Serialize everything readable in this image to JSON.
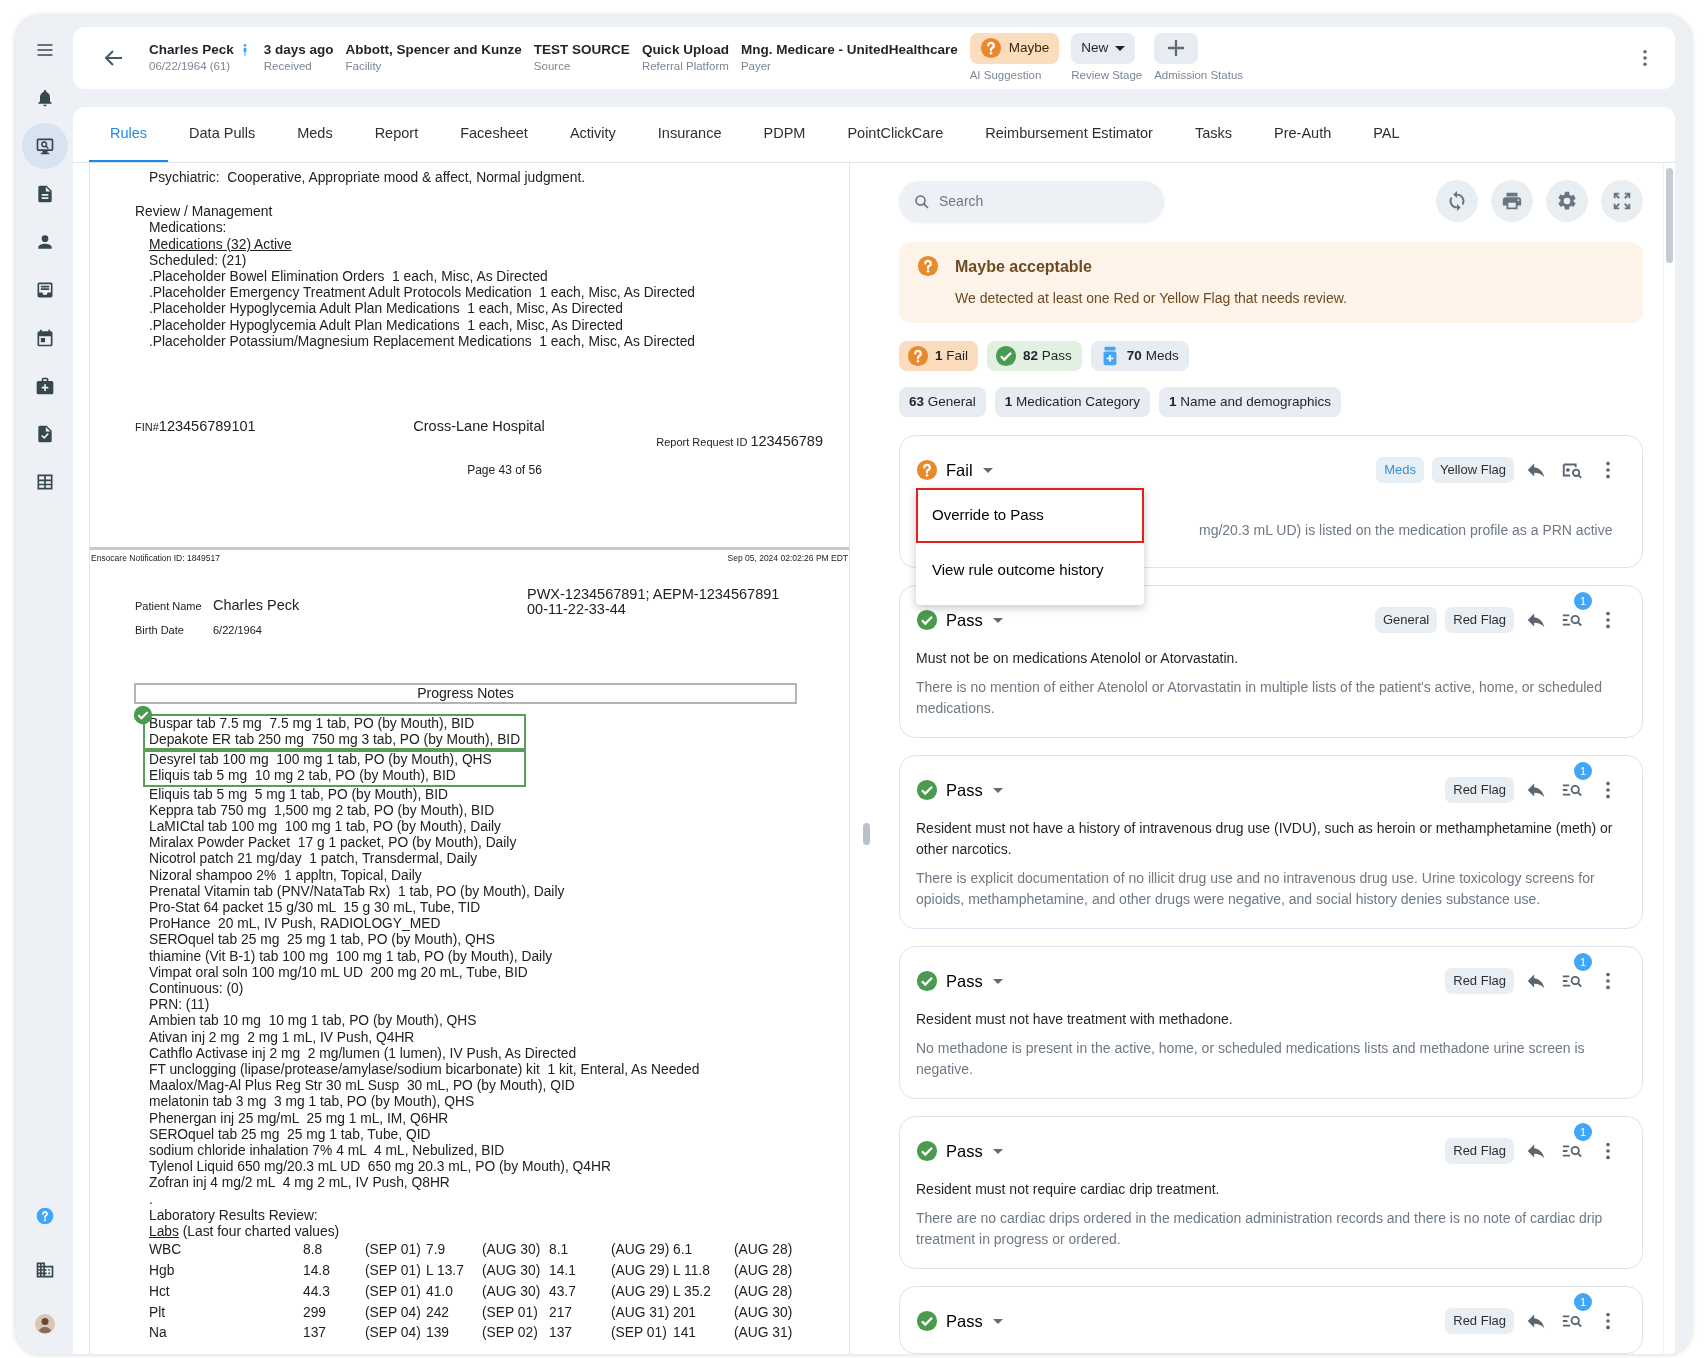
{
  "sidebar": {
    "items": [
      {
        "selected": false
      },
      {
        "selected": true
      },
      {
        "selected": false
      },
      {
        "selected": false
      },
      {
        "selected": false
      },
      {
        "selected": false
      },
      {
        "selected": false
      },
      {
        "selected": false
      },
      {
        "selected": false
      }
    ]
  },
  "header": {
    "patient": {
      "name": "Charles Peck",
      "dob": "06/22/1964 (61)"
    },
    "fields": [
      {
        "value": "3 days ago",
        "label": "Received"
      },
      {
        "value": "Abbott, Spencer and Kunze",
        "label": "Facility"
      },
      {
        "value": "TEST SOURCE",
        "label": "Source"
      },
      {
        "value": "Quick Upload",
        "label": "Referral Platform"
      },
      {
        "value": "Mng. Medicare - UnitedHealthcare",
        "label": "Payer"
      }
    ],
    "ai_suggestion": {
      "value": "Maybe",
      "label": "AI Suggestion"
    },
    "review_stage": {
      "value": "New",
      "label": "Review Stage"
    },
    "admission_status": {
      "label": "Admission Status"
    }
  },
  "tabs": [
    {
      "label": "Rules",
      "selected": true
    },
    {
      "label": "Data Pulls",
      "selected": false
    },
    {
      "label": "Meds",
      "selected": false
    },
    {
      "label": "Report",
      "selected": false
    },
    {
      "label": "Facesheet",
      "selected": false
    },
    {
      "label": "Activity",
      "selected": false
    },
    {
      "label": "Insurance",
      "selected": false
    },
    {
      "label": "PDPM",
      "selected": false
    },
    {
      "label": "PointClickCare",
      "selected": false
    },
    {
      "label": "Reimbursement Estimator",
      "selected": false
    },
    {
      "label": "Tasks",
      "selected": false
    },
    {
      "label": "Pre-Auth",
      "selected": false
    },
    {
      "label": "PAL",
      "selected": false
    }
  ],
  "document": {
    "intro": "Psychiatric:  Cooperative, Appropriate mood & affect, Normal judgment.",
    "review_heading": "Review / Management",
    "review_lines": [
      {
        "kind": "text",
        "text": "Medications:"
      },
      {
        "kind": "link",
        "text": "Medications (32) Active"
      },
      {
        "kind": "text",
        "text": "Scheduled: (21)"
      },
      {
        "kind": "text",
        "text": ".Placeholder Bowel Elimination Orders  1 each, Misc, As Directed"
      },
      {
        "kind": "text",
        "text": ".Placeholder Emergency Treatment Adult Protocols Medication  1 each, Misc, As Directed"
      },
      {
        "kind": "text",
        "text": ".Placeholder Hypoglycemia Adult Plan Medications  1 each, Misc, As Directed"
      },
      {
        "kind": "text",
        "text": ".Placeholder Hypoglycemia Adult Plan Medications  1 each, Misc, As Directed"
      },
      {
        "kind": "text",
        "text": ".Placeholder Potassium/Magnesium Replacement Medications  1 each, Misc, As Directed"
      }
    ],
    "footer": {
      "fin_label": "FIN#",
      "fin": "123456789101",
      "hospital": "Cross-Lane Hospital",
      "report_label": "Report Request ID",
      "report_id": "123456789",
      "page": "Page 43 of 56"
    },
    "page_header": {
      "notification": "Ensocare Notification ID: 1849517",
      "timestamp": "Sep 05, 2024 02:02:26 PM EDT"
    },
    "patient": {
      "name_label": "Patient Name",
      "name": "Charles Peck",
      "birth_label": "Birth Date",
      "birth": "6/22/1964",
      "ids": [
        "PWX-1234567891; AEPM-1234567891",
        "00-11-22-33-44"
      ]
    },
    "notes_title": "Progress Notes",
    "highlight_groups": [
      [
        "Buspar tab 7.5 mg  7.5 mg 1 tab, PO (by Mouth), BID",
        "Depakote ER tab 250 mg  750 mg 3 tab, PO (by Mouth), BID"
      ],
      [
        "Desyrel tab 100 mg  100 mg 1 tab, PO (by Mouth), QHS",
        "Eliquis tab 5 mg  10 mg 2 tab, PO (by Mouth), BID"
      ]
    ],
    "med_lines": [
      "Eliquis tab 5 mg  5 mg 1 tab, PO (by Mouth), BID",
      "Keppra tab 750 mg  1,500 mg 2 tab, PO (by Mouth), BID",
      "LaMICtal tab 100 mg  100 mg 1 tab, PO (by Mouth), Daily",
      "Miralax Powder Packet  17 g 1 packet, PO (by Mouth), Daily",
      "Nicotrol patch 21 mg/day  1 patch, Transdermal, Daily",
      "Nizoral shampoo 2%  1 appltn, Topical, Daily",
      "Prenatal Vitamin tab (PNV/NataTab Rx)  1 tab, PO (by Mouth), Daily",
      "Pro-Stat 64 packet 15 g/30 mL  15 g 30 mL, Tube, TID",
      "ProHance  20 mL, IV Push, RADIOLOGY_MED",
      "SEROquel tab 25 mg  25 mg 1 tab, PO (by Mouth), QHS",
      "thiamine (Vit B-1) tab 100 mg  100 mg 1 tab, PO (by Mouth), Daily",
      "Vimpat oral soln 100 mg/10 mL UD  200 mg 20 mL, Tube, BID",
      "Continuous: (0)",
      "PRN: (11)",
      "Ambien tab 10 mg  10 mg 1 tab, PO (by Mouth), QHS",
      "Ativan inj 2 mg  2 mg 1 mL, IV Push, Q4HR",
      "Cathflo Activase inj 2 mg  2 mg/lumen (1 lumen), IV Push, As Directed",
      "FT unclogging (lipase/protease/amylase/sodium bicarbonate) kit  1 kit, Enteral, As Needed",
      "Maalox/Mag-Al Plus Reg Str 30 mL Susp  30 mL, PO (by Mouth), QID",
      "melatonin tab 3 mg  3 mg 1 tab, PO (by Mouth), QHS",
      "Phenergan inj 25 mg/mL  25 mg 1 mL, IM, Q6HR",
      "SEROquel tab 25 mg  25 mg 1 tab, Tube, QID",
      "sodium chloride inhalation 7% 4 mL  4 mL, Nebulized, BID",
      "Tylenol Liquid 650 mg/20.3 mL UD  650 mg 20.3 mL, PO (by Mouth), Q4HR",
      "Zofran inj 4 mg/2 mL  4 mg 2 mL, IV Push, Q8HR",
      "."
    ],
    "labs_heading": "Laboratory Results Review:",
    "labs_link": "Labs",
    "labs_note": "(Last four charted values)",
    "lab_rows": [
      [
        "WBC",
        "8.8",
        "(SEP 01)",
        "7.9",
        "(AUG 30)",
        "8.1",
        "(AUG 29)",
        "6.1",
        "(AUG 28)"
      ],
      [
        "Hgb",
        "14.8",
        "(SEP 01)",
        "L 13.7",
        "(AUG 30)",
        "14.1",
        "(AUG 29)",
        "L 11.8",
        "(AUG 28)"
      ],
      [
        "Hct",
        "44.3",
        "(SEP 01)",
        "41.0",
        "(AUG 30)",
        "43.7",
        "(AUG 29)",
        "L 35.2",
        "(AUG 28)"
      ],
      [
        "Plt",
        "299",
        "(SEP 04)",
        "242",
        "(SEP 01)",
        "217",
        "(AUG 31)",
        "201",
        "(AUG 30)"
      ],
      [
        "Na",
        "137",
        "(SEP 04)",
        "139",
        "(SEP 02)",
        "137",
        "(SEP 01)",
        "141",
        "(AUG 31)"
      ]
    ]
  },
  "rules_panel": {
    "search": {
      "placeholder": "Search"
    },
    "alert": {
      "title": "Maybe acceptable",
      "message": "We detected at least one Red or Yellow Flag that needs review."
    },
    "summary": [
      {
        "kind": "fail",
        "count": "1",
        "label": "Fail"
      },
      {
        "kind": "pass",
        "count": "82",
        "label": "Pass"
      },
      {
        "kind": "meds",
        "count": "70",
        "label": "Meds"
      }
    ],
    "categories": [
      {
        "count": "63",
        "label": "General"
      },
      {
        "count": "1",
        "label": "Medication Category"
      },
      {
        "count": "1",
        "label": "Name and demographics"
      }
    ],
    "rules": [
      {
        "kind": "fail",
        "status": "Fail",
        "tags": [
          {
            "kind": "link",
            "label": "Meds"
          },
          {
            "kind": "plain",
            "label": "Yellow Flag"
          }
        ],
        "description": "mg/20.3 mL UD) is listed on the medication profile as a PRN active",
        "menu": [
          {
            "label": "Override to Pass",
            "selected": true
          },
          {
            "label": "View rule outcome history",
            "selected": false
          }
        ]
      },
      {
        "kind": "pass",
        "status": "Pass",
        "tags": [
          {
            "kind": "plain",
            "label": "General"
          },
          {
            "kind": "plain",
            "label": "Red Flag"
          }
        ],
        "badge": "1",
        "title": "Must not be on medications Atenolol or Atorvastatin.",
        "description": "There is no mention of either Atenolol or Atorvastatin in multiple lists of the patient's active, home, or scheduled medications."
      },
      {
        "kind": "pass",
        "status": "Pass",
        "tags": [
          {
            "kind": "plain",
            "label": "Red Flag"
          }
        ],
        "badge": "1",
        "title": "Resident must not have a history of intravenous drug use (IVDU), such as heroin or methamphetamine (meth) or other narcotics.",
        "description": "There is explicit documentation of no illicit drug use and no intravenous drug use. Urine toxicology screens for opioids, methamphetamine, and other drugs were negative, and social history denies substance use."
      },
      {
        "kind": "pass",
        "status": "Pass",
        "tags": [
          {
            "kind": "plain",
            "label": "Red Flag"
          }
        ],
        "badge": "1",
        "title": "Resident must not have treatment with methadone.",
        "description": "No methadone is present in the active, home, or scheduled medications lists and methadone urine screen is negative."
      },
      {
        "kind": "pass",
        "status": "Pass",
        "tags": [
          {
            "kind": "plain",
            "label": "Red Flag"
          }
        ],
        "badge": "1",
        "title": "Resident must not require cardiac drip treatment.",
        "description": "There are no cardiac drips ordered in the medication administration records and there is no note of cardiac drip treatment in progress or ordered."
      },
      {
        "kind": "pass",
        "status": "Pass",
        "tags": [
          {
            "kind": "plain",
            "label": "Red Flag"
          }
        ],
        "badge": "1"
      }
    ]
  }
}
